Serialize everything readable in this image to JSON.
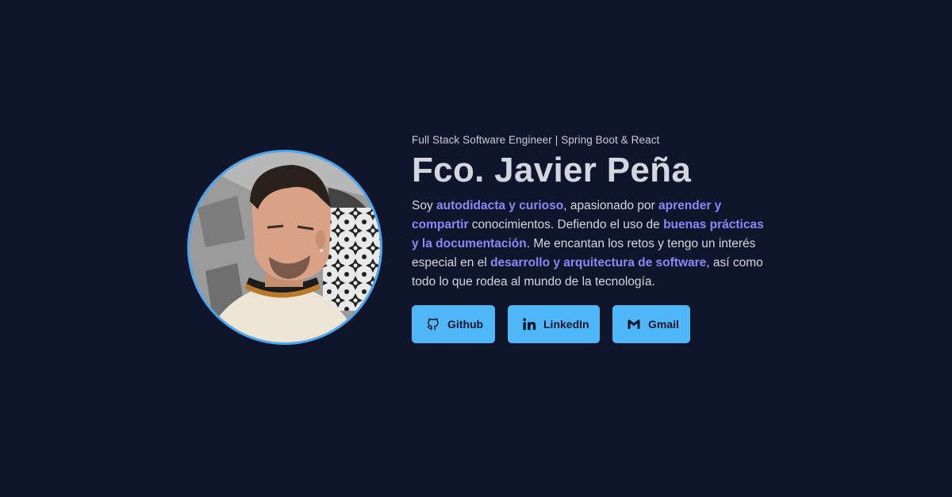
{
  "profile": {
    "subtitle": "Full Stack Software Engineer | Spring Boot & React",
    "name": "Fco. Javier Peña",
    "bio": [
      {
        "text": "Soy ",
        "highlight": false
      },
      {
        "text": "autodidacta y curioso",
        "highlight": true
      },
      {
        "text": ", apasionado por ",
        "highlight": false
      },
      {
        "text": "aprender y compartir",
        "highlight": true
      },
      {
        "text": " conocimientos. Defiendo el uso de ",
        "highlight": false
      },
      {
        "text": "buenas prácticas y la documentación",
        "highlight": true
      },
      {
        "text": ". Me encantan los retos y tengo un interés especial en el ",
        "highlight": false
      },
      {
        "text": "desarrollo y arquitectura de software",
        "highlight": true
      },
      {
        "text": ", así como todo lo que rodea al mundo de la tecnología.",
        "highlight": false
      }
    ],
    "avatar_icon": "profile-photo"
  },
  "buttons": [
    {
      "label": "Github",
      "icon": "github-icon"
    },
    {
      "label": "LinkedIn",
      "icon": "linkedin-icon"
    },
    {
      "label": "Gmail",
      "icon": "gmail-icon"
    }
  ],
  "colors": {
    "background": "#0f152a",
    "accent": "#4fb7f7",
    "highlight": "#8e87f7",
    "avatar_border": "#4aa8f0"
  }
}
